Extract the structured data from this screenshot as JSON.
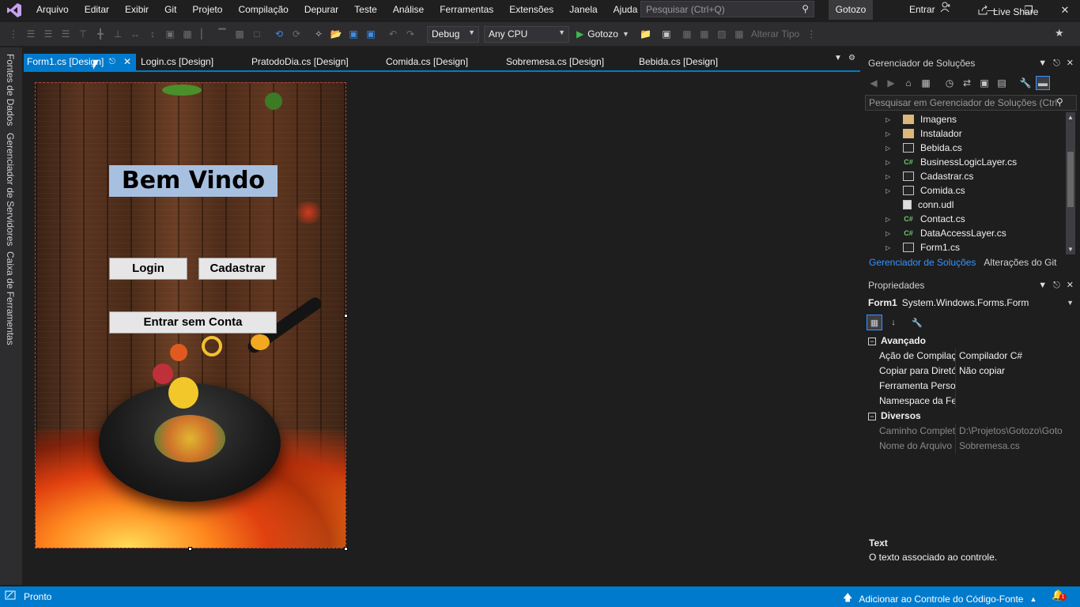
{
  "menubar": {
    "items": [
      "Arquivo",
      "Editar",
      "Exibir",
      "Git",
      "Projeto",
      "Compilação",
      "Depurar",
      "Teste",
      "Análise",
      "Ferramentas",
      "Extensões",
      "Janela",
      "Ajuda"
    ],
    "search_placeholder": "Pesquisar (Ctrl+Q)",
    "solution_name": "Gotozo",
    "signin_label": "Entrar"
  },
  "toolbar": {
    "config": "Debug",
    "platform": "Any CPU",
    "start_label": "Gotozo",
    "change_type_label": "Alterar Tipo",
    "live_share_label": "Live Share"
  },
  "left_strip": {
    "tabs": [
      "Fontes de Dados",
      "Gerenciador de Servidores",
      "Caixa de Ferramentas"
    ]
  },
  "doc_tabs": [
    "Form1.cs [Design]",
    "Login.cs [Design]",
    "PratodoDia.cs [Design]",
    "Comida.cs [Design]",
    "Sobremesa.cs [Design]",
    "Bebida.cs [Design]"
  ],
  "form_preview": {
    "title": "Bem Vindo",
    "login_button": "Login",
    "register_button": "Cadastrar",
    "guest_button": "Entrar sem Conta"
  },
  "solution_explorer": {
    "title": "Gerenciador de Soluções",
    "search_placeholder": "Pesquisar em Gerenciador de Soluções (Ctrl",
    "items": [
      {
        "label": "Imagens",
        "icon": "folder-icon"
      },
      {
        "label": "Instalador",
        "icon": "folder-icon"
      },
      {
        "label": "Bebida.cs",
        "icon": "form-icon"
      },
      {
        "label": "BusinessLogicLayer.cs",
        "icon": "csharp-icon"
      },
      {
        "label": "Cadastrar.cs",
        "icon": "form-icon"
      },
      {
        "label": "Comida.cs",
        "icon": "form-icon"
      },
      {
        "label": "conn.udl",
        "icon": "file-icon"
      },
      {
        "label": "Contact.cs",
        "icon": "csharp-icon"
      },
      {
        "label": "DataAccessLayer.cs",
        "icon": "csharp-icon"
      },
      {
        "label": "Form1.cs",
        "icon": "form-icon"
      }
    ],
    "bottom_tabs": [
      "Gerenciador de Soluções",
      "Alterações do Git"
    ]
  },
  "properties": {
    "title": "Propriedades",
    "object_name": "Form1",
    "object_type": "System.Windows.Forms.Form",
    "categories": [
      {
        "name": "Avançado",
        "rows": [
          {
            "key": "Ação de Compilação",
            "value": "Compilador C#",
            "dim": false
          },
          {
            "key": "Copiar para Diretório",
            "value": "Não copiar",
            "dim": false
          },
          {
            "key": "Ferramenta Personali",
            "value": "",
            "dim": false
          },
          {
            "key": "Namespace da Ferrar",
            "value": "",
            "dim": false
          }
        ]
      },
      {
        "name": "Diversos",
        "rows": [
          {
            "key": "Caminho Completo",
            "value": "D:\\Projetos\\Gotozo\\Goto",
            "dim": true
          },
          {
            "key": "Nome do Arquivo",
            "value": "Sobremesa.cs",
            "dim": true
          }
        ]
      }
    ],
    "desc_title": "Text",
    "desc_text": "O texto associado ao controle."
  },
  "statusbar": {
    "ready": "Pronto",
    "source_control": "Adicionar ao Controle do Código-Fonte",
    "notif_count": "1"
  },
  "colors": {
    "accent": "#007acc",
    "background": "#1e1e1e",
    "panel": "#2d2d30"
  }
}
